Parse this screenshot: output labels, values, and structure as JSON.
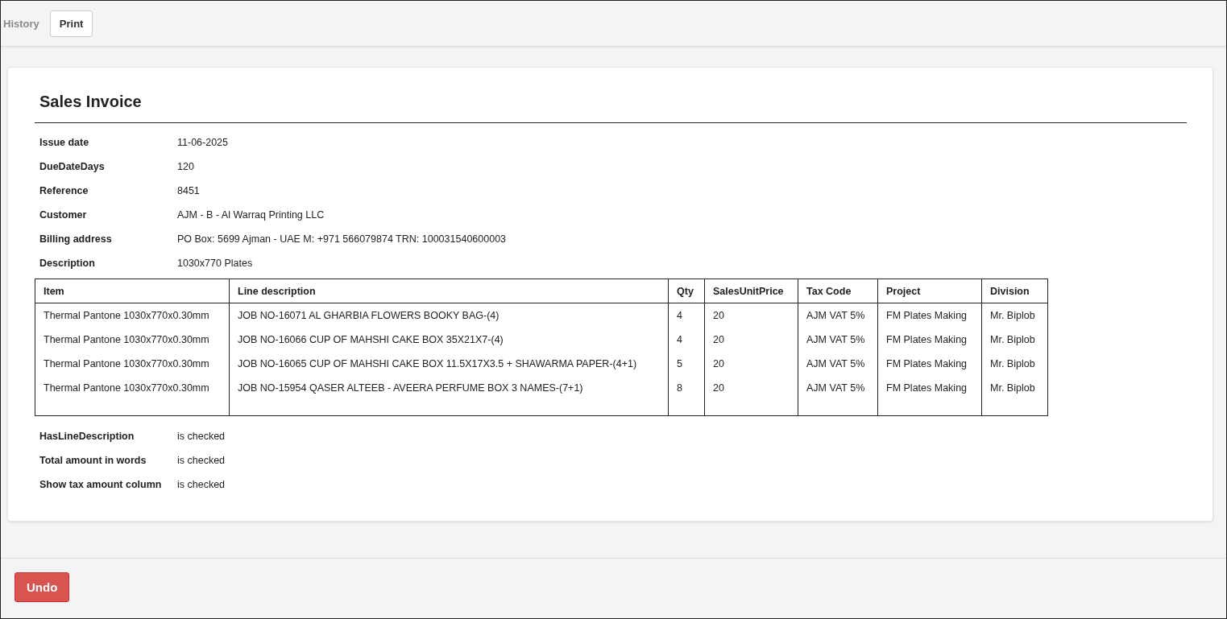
{
  "toolbar": [
    {
      "label": "History",
      "disabled": true
    },
    {
      "label": "Print",
      "disabled": false
    }
  ],
  "title": "Sales Invoice",
  "fields": [
    {
      "label": "Issue date",
      "value": "11-06-2025"
    },
    {
      "label": "DueDateDays",
      "value": "120"
    },
    {
      "label": "Reference",
      "value": "8451"
    },
    {
      "label": "Customer",
      "value": "AJM - B - Al Warraq Printing LLC"
    },
    {
      "label": "Billing address",
      "value": "PO Box: 5699 Ajman - UAE M: +971 566079874 TRN: 100031540600003"
    },
    {
      "label": "Description",
      "value": "1030x770 Plates"
    }
  ],
  "table": {
    "columns": [
      "Item",
      "Line description",
      "Qty",
      "SalesUnitPrice",
      "Tax Code",
      "Project",
      "Division"
    ],
    "rows": [
      [
        "Thermal Pantone 1030x770x0.30mm",
        "JOB NO-16071 AL GHARBIA FLOWERS BOOKY BAG-(4)",
        "4",
        "20",
        "AJM VAT 5%",
        "FM Plates Making",
        "Mr. Biplob"
      ],
      [
        "Thermal Pantone 1030x770x0.30mm",
        "JOB NO-16066 CUP OF MAHSHI CAKE BOX 35X21X7-(4)",
        "4",
        "20",
        "AJM VAT 5%",
        "FM Plates Making",
        "Mr. Biplob"
      ],
      [
        "Thermal Pantone 1030x770x0.30mm",
        "JOB NO-16065 CUP OF MAHSHI CAKE BOX 11.5X17X3.5 + SHAWARMA PAPER-(4+1)",
        "5",
        "20",
        "AJM VAT 5%",
        "FM Plates Making",
        "Mr. Biplob"
      ],
      [
        "Thermal Pantone 1030x770x0.30mm",
        "JOB NO-15954 QASER ALTEEB - AVEERA PERFUME BOX 3 NAMES-(7+1)",
        "8",
        "20",
        "AJM VAT 5%",
        "FM Plates Making",
        "Mr. Biplob"
      ]
    ]
  },
  "options": [
    {
      "label": "HasLineDescription",
      "value": "is checked"
    },
    {
      "label": "Total amount in words",
      "value": "is checked"
    },
    {
      "label": "Show tax amount column",
      "value": "is checked"
    }
  ],
  "footer": {
    "undo": "Undo"
  }
}
